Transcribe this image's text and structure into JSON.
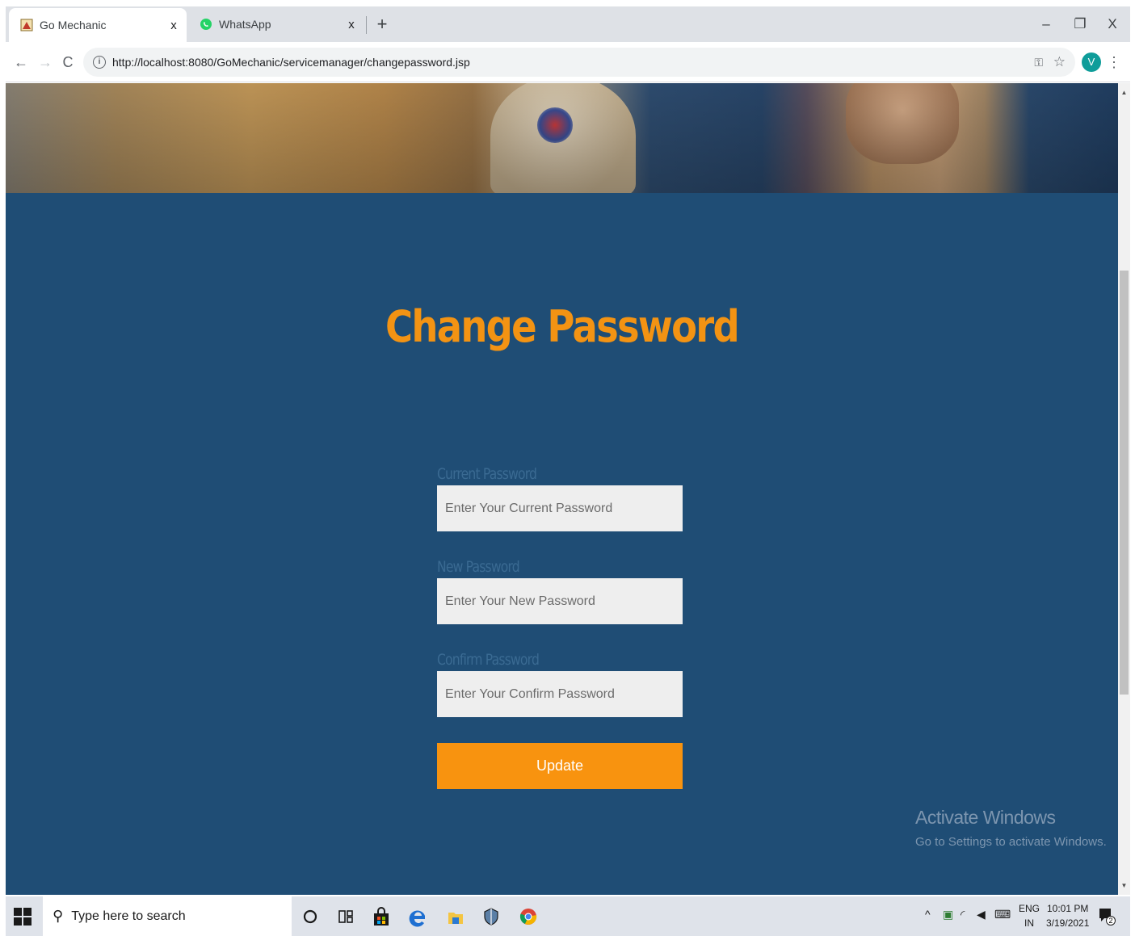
{
  "browser": {
    "tabs": [
      {
        "title": "Go Mechanic",
        "close": "x",
        "active": true
      },
      {
        "title": "WhatsApp",
        "close": "x",
        "active": false
      }
    ],
    "new_tab": "+",
    "window_controls": {
      "minimize": "–",
      "maximize": "❐",
      "close": "X"
    },
    "url": "http://localhost:8080/GoMechanic/servicemanager/changepassword.jsp",
    "avatar_letter": "V"
  },
  "page": {
    "heading": "Change Password",
    "fields": [
      {
        "label": "Current Password",
        "placeholder": "Enter Your Current Password",
        "value": ""
      },
      {
        "label": "New Password",
        "placeholder": "Enter Your New Password",
        "value": ""
      },
      {
        "label": "Confirm Password",
        "placeholder": "Enter Your Confirm Password",
        "value": ""
      }
    ],
    "submit_label": "Update",
    "colors": {
      "background": "#1f4d75",
      "accent": "#f8930f",
      "field": "#eeeeee"
    }
  },
  "watermark": {
    "title": "Activate Windows",
    "subtitle": "Go to Settings to activate Windows."
  },
  "taskbar": {
    "search_placeholder": "Type here to search",
    "language": "ENG",
    "region": "IN",
    "time": "10:01 PM",
    "date": "3/19/2021",
    "notification_count": "2"
  }
}
